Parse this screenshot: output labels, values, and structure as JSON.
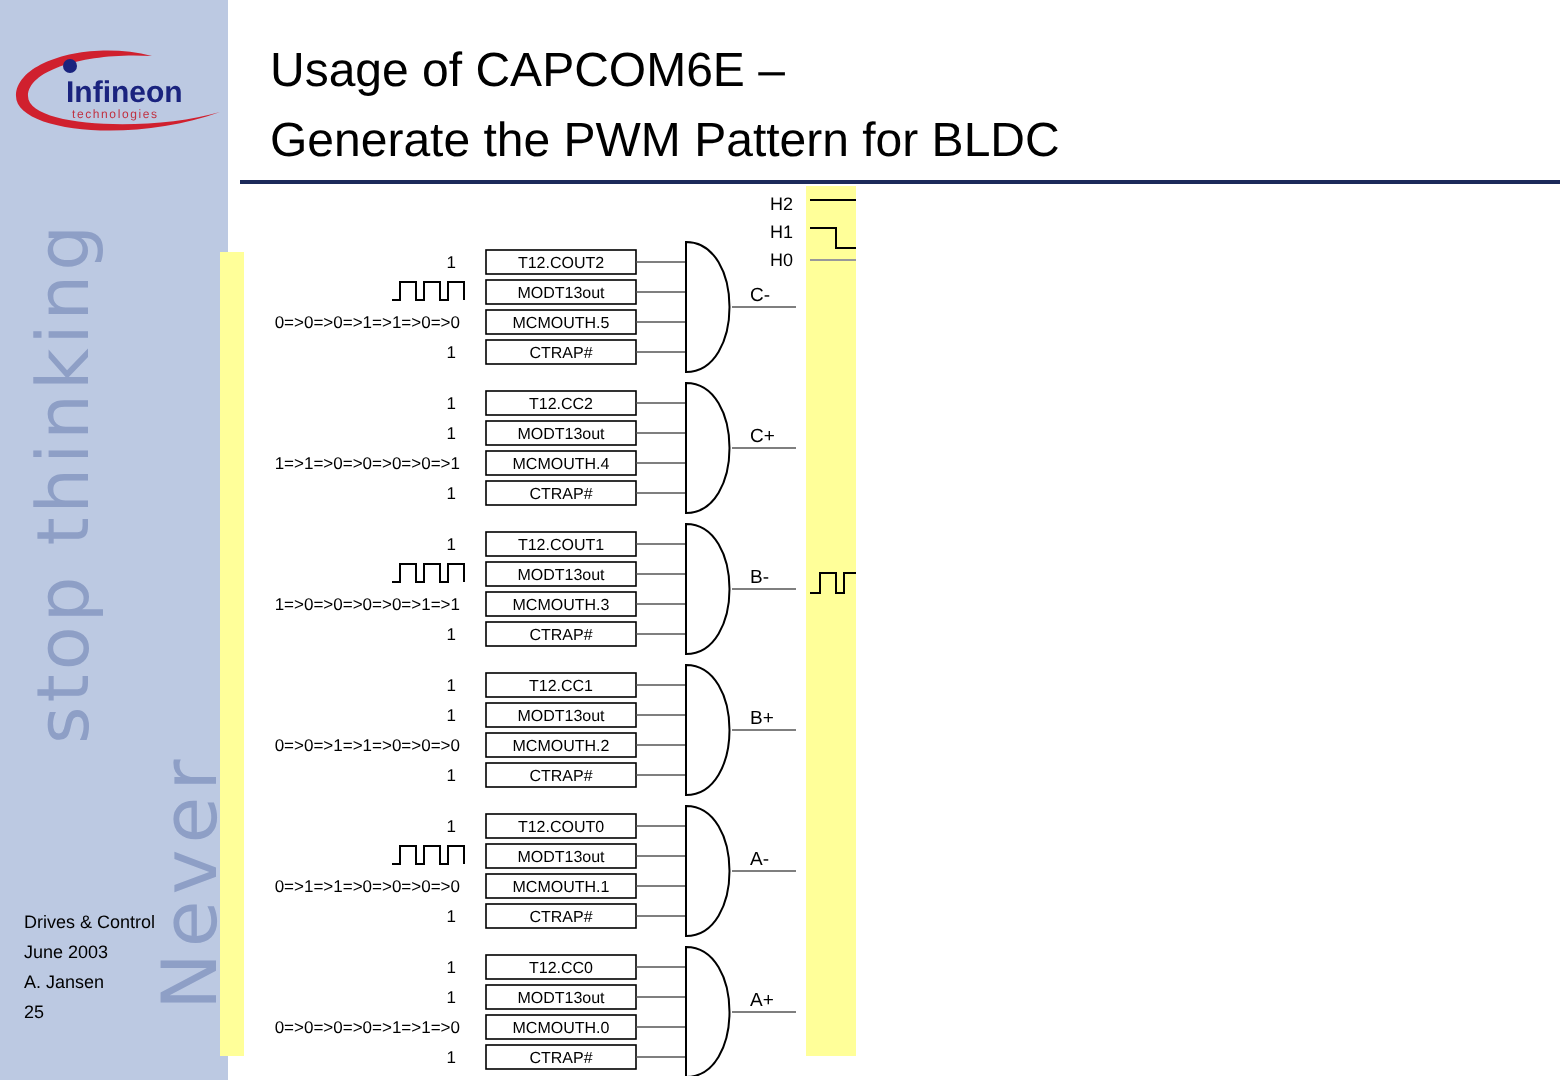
{
  "sidebar": {
    "logo": {
      "name": "Infineon",
      "tagline": "technologies"
    },
    "slogan": [
      "Never",
      "stop thinking"
    ],
    "footer": [
      "Drives & Control",
      "June 2003",
      "A. Jansen",
      "25"
    ]
  },
  "title": [
    "Usage of CAPCOM6E –",
    "Generate the PWM Pattern for BLDC"
  ],
  "hall_labels": [
    "H2",
    "H1",
    "H0"
  ],
  "gates": [
    {
      "output": "C-",
      "output_pulse": false,
      "inputs": [
        {
          "kind": "text",
          "value": "1",
          "signal": "T12.COUT2"
        },
        {
          "kind": "pulse",
          "signal": "MODT13out"
        },
        {
          "kind": "text",
          "value": "0=>0=>0=>1=>1=>0=>0",
          "signal": "MCMOUTH.5"
        },
        {
          "kind": "text",
          "value": "1",
          "signal": "CTRAP#"
        }
      ]
    },
    {
      "output": "C+",
      "output_pulse": false,
      "inputs": [
        {
          "kind": "text",
          "value": "1",
          "signal": "T12.CC2"
        },
        {
          "kind": "text",
          "value": "1",
          "signal": "MODT13out"
        },
        {
          "kind": "text",
          "value": "1=>1=>0=>0=>0=>0=>1",
          "signal": "MCMOUTH.4"
        },
        {
          "kind": "text",
          "value": "1",
          "signal": "CTRAP#"
        }
      ]
    },
    {
      "output": "B-",
      "output_pulse": true,
      "inputs": [
        {
          "kind": "text",
          "value": "1",
          "signal": "T12.COUT1"
        },
        {
          "kind": "pulse",
          "signal": "MODT13out"
        },
        {
          "kind": "text",
          "value": "1=>0=>0=>0=>0=>1=>1",
          "signal": "MCMOUTH.3"
        },
        {
          "kind": "text",
          "value": "1",
          "signal": "CTRAP#"
        }
      ]
    },
    {
      "output": "B+",
      "output_pulse": false,
      "inputs": [
        {
          "kind": "text",
          "value": "1",
          "signal": "T12.CC1"
        },
        {
          "kind": "text",
          "value": "1",
          "signal": "MODT13out"
        },
        {
          "kind": "text",
          "value": "0=>0=>1=>1=>0=>0=>0",
          "signal": "MCMOUTH.2"
        },
        {
          "kind": "text",
          "value": "1",
          "signal": "CTRAP#"
        }
      ]
    },
    {
      "output": "A-",
      "output_pulse": false,
      "inputs": [
        {
          "kind": "text",
          "value": "1",
          "signal": "T12.COUT0"
        },
        {
          "kind": "pulse",
          "signal": "MODT13out"
        },
        {
          "kind": "text",
          "value": "0=>1=>1=>0=>0=>0=>0",
          "signal": "MCMOUTH.1"
        },
        {
          "kind": "text",
          "value": "1",
          "signal": "CTRAP#"
        }
      ]
    },
    {
      "output": "A+",
      "output_pulse": false,
      "inputs": [
        {
          "kind": "text",
          "value": "1",
          "signal": "T12.CC0"
        },
        {
          "kind": "text",
          "value": "1",
          "signal": "MODT13out"
        },
        {
          "kind": "text",
          "value": "0=>0=>0=>0=>1=>1=>0",
          "signal": "MCMOUTH.0"
        },
        {
          "kind": "text",
          "value": "1",
          "signal": "CTRAP#"
        }
      ]
    }
  ]
}
